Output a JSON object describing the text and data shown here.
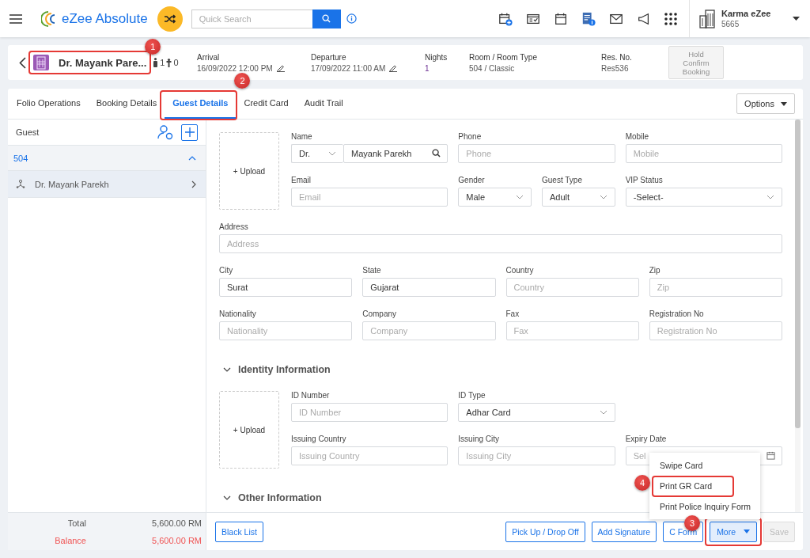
{
  "top_bar": {
    "app_name": "eZee Absolute",
    "search": {
      "placeholder": "Quick Search"
    },
    "user": {
      "name": "Karma eZee",
      "code": "5665"
    }
  },
  "reservation": {
    "guest_name": "Dr. Mayank Pare...",
    "callout": "1",
    "adults": "1",
    "children": "0",
    "details": [
      {
        "label": "Arrival",
        "value": "16/09/2022 12:00 PM",
        "editable": true
      },
      {
        "label": "Departure",
        "value": "17/09/2022 11:00 AM",
        "editable": true
      },
      {
        "label": "Nights",
        "value": "1",
        "editable": false
      },
      {
        "label": "Room / Room Type",
        "value": "504 / Classic",
        "editable": false
      },
      {
        "label": "Res. No.",
        "value": "Res536",
        "editable": false
      }
    ],
    "hold_button": {
      "label": "Hold Confirm Booking",
      "disabled": true
    }
  },
  "tabs": [
    {
      "label": "Folio Operations",
      "selected": false
    },
    {
      "label": "Booking Details",
      "selected": false
    },
    {
      "label": "Guest Details",
      "selected": true,
      "callout": "2"
    },
    {
      "label": "Credit Card",
      "selected": false
    },
    {
      "label": "Audit Trail",
      "selected": false
    }
  ],
  "options_button": "Options",
  "guest_panel": {
    "title": "Guest",
    "rooms": [
      {
        "room": "504",
        "expanded": true,
        "guests": [
          {
            "name": "Dr. Mayank Parekh",
            "selected": true
          }
        ]
      }
    ],
    "totals": [
      {
        "label": "Total",
        "value": "5,600.00 RM",
        "kind": "total"
      },
      {
        "label": "Balance",
        "value": "5,600.00 RM",
        "kind": "balance"
      }
    ]
  },
  "personal": {
    "upload": "+ Upload",
    "rows": [
      [
        {
          "kind": "title-name",
          "label": "Name",
          "title": "Dr.",
          "value": "Mayank Parekh"
        },
        {
          "kind": "input",
          "label": "Phone",
          "placeholder": "Phone"
        },
        {
          "kind": "input",
          "label": "Mobile",
          "placeholder": "Mobile"
        }
      ],
      [
        {
          "kind": "input",
          "label": "Email",
          "placeholder": "Email"
        },
        {
          "kind": "group",
          "fields": [
            {
              "kind": "select",
              "label": "Gender",
              "value": "Male"
            },
            {
              "kind": "select",
              "label": "Guest Type",
              "value": "Adult"
            }
          ]
        },
        {
          "kind": "select",
          "label": "VIP Status",
          "value": "-Select-"
        }
      ]
    ]
  },
  "address": {
    "rows": [
      [
        {
          "kind": "input",
          "label": "Address",
          "placeholder": "Address"
        }
      ],
      [
        {
          "kind": "input",
          "label": "City",
          "value": "Surat"
        },
        {
          "kind": "input",
          "label": "State",
          "value": "Gujarat"
        },
        {
          "kind": "input",
          "label": "Country",
          "placeholder": "Country"
        },
        {
          "kind": "input",
          "label": "Zip",
          "placeholder": "Zip"
        }
      ],
      [
        {
          "kind": "input",
          "label": "Nationality",
          "placeholder": "Nationality"
        },
        {
          "kind": "input",
          "label": "Company",
          "placeholder": "Company"
        },
        {
          "kind": "input",
          "label": "Fax",
          "placeholder": "Fax"
        },
        {
          "kind": "input",
          "label": "Registration No",
          "placeholder": "Registration No"
        }
      ]
    ]
  },
  "sections": [
    {
      "title": "Identity Information",
      "expanded": true,
      "upload": "+ Upload",
      "rows": [
        [
          {
            "kind": "input",
            "label": "ID Number",
            "placeholder": "ID Number"
          },
          {
            "kind": "select",
            "label": "ID Type",
            "value": "Adhar Card"
          }
        ],
        [
          {
            "kind": "input",
            "label": "Issuing Country",
            "placeholder": "Issuing Country"
          },
          {
            "kind": "input",
            "label": "Issuing City",
            "placeholder": "Issuing City"
          },
          {
            "kind": "date",
            "label": "Expiry Date",
            "placeholder": "Sel"
          }
        ]
      ]
    },
    {
      "title": "Other Information",
      "expanded": true
    }
  ],
  "footer": {
    "left_buttons": [
      {
        "label": "Black List"
      }
    ],
    "right_buttons": [
      {
        "label": "Pick Up / Drop Off",
        "kind": "outline"
      },
      {
        "label": "Add Signature",
        "kind": "outline"
      },
      {
        "label": "C Form",
        "kind": "outline"
      },
      {
        "label": "More",
        "kind": "menu",
        "expanded": true,
        "callout": "3"
      },
      {
        "label": "Save",
        "kind": "outline",
        "disabled": true
      }
    ]
  },
  "more_menu": [
    {
      "label": "Swipe Card"
    },
    {
      "label": "Print GR Card",
      "callout": "4"
    },
    {
      "label": "Print Police Inquiry Form"
    }
  ]
}
